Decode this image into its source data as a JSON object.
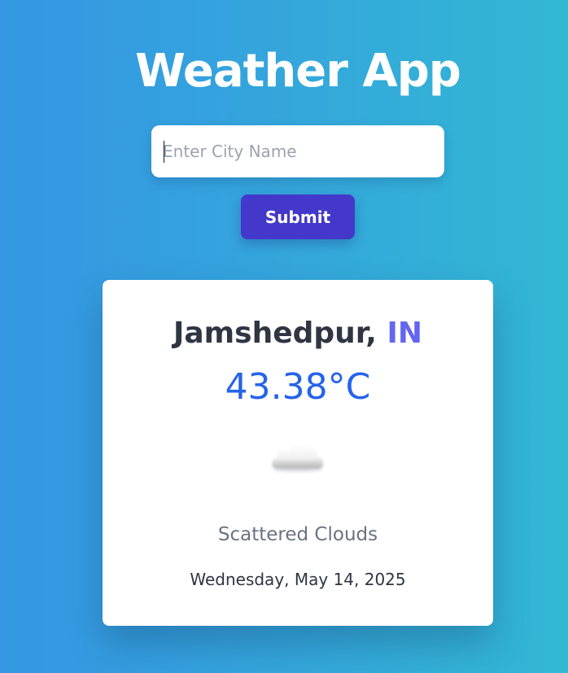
{
  "app": {
    "title": "Weather App"
  },
  "search": {
    "placeholder": "Enter City Name",
    "value": "",
    "submit_label": "Submit"
  },
  "weather": {
    "city": "Jamshedpur",
    "separator": ", ",
    "country": "IN",
    "temperature": "43.38°C",
    "icon": "cloud-icon",
    "description": "Scattered Clouds",
    "date": "Wednesday, May 14, 2025"
  },
  "colors": {
    "background_start": "#3597e3",
    "background_end": "#32b8d3",
    "button": "#4338ca",
    "temperature": "#2563eb",
    "country": "#6366f1",
    "city": "#2f3542",
    "description": "#6b7280"
  }
}
